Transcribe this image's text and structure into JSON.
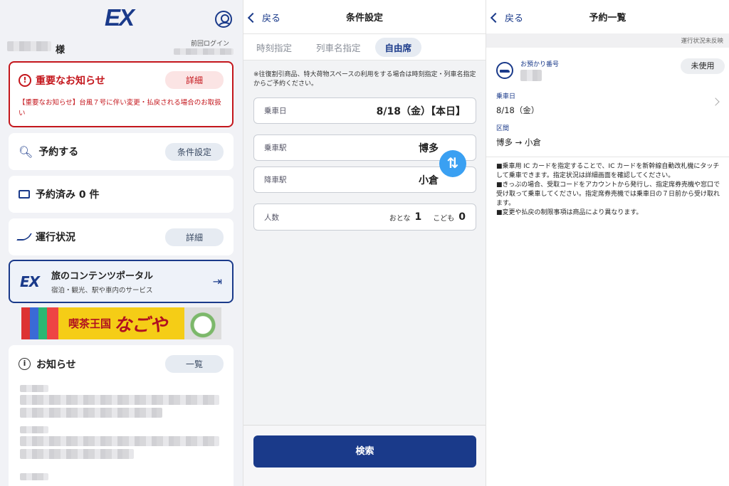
{
  "home": {
    "logo": "EX",
    "user_suffix": "様",
    "last_login_label": "前回ログイン",
    "alert": {
      "title": "重要なお知らせ",
      "button": "詳細",
      "body": "【重要なお知らせ】台風７号に伴い変更・払戻される場合のお取扱い"
    },
    "reserve": {
      "title": "予約する",
      "button": "条件設定"
    },
    "reserved": {
      "title": "予約済み 0 件"
    },
    "operation": {
      "title": "運行状況",
      "button": "詳細"
    },
    "portal": {
      "logo": "EX",
      "title": "旅のコンテンツポータル",
      "subtitle": "宿泊・観光、駅や車内のサービス"
    },
    "banner": {
      "text1": "喫茶王国",
      "text2": "なごや"
    },
    "notices": {
      "title": "お知らせ",
      "button": "一覧"
    },
    "accent": "#1a3a8a",
    "alert_color": "#c4161c"
  },
  "conditions": {
    "back": "戻る",
    "title": "条件設定",
    "tabs": [
      "時刻指定",
      "列車名指定",
      "自由席"
    ],
    "active_tab": "自由席",
    "note": "※往復割引商品、特大荷物スペースの利用をする場合は時刻指定・列車名指定からご予約ください。",
    "date_label": "乗車日",
    "date_value": "8/18（金）【本日】",
    "from_label": "乗車駅",
    "from_value": "博多",
    "to_label": "降車駅",
    "to_value": "小倉",
    "persons_label": "人数",
    "adult_label": "おとな",
    "adult_count": "1",
    "child_label": "こども",
    "child_count": "0",
    "search_button": "検索",
    "swap_icon": "swap-arrows-icon"
  },
  "reservations": {
    "back": "戻る",
    "title": "予約一覧",
    "status_note": "運行状況未反映",
    "booking_label": "お預かり番号",
    "status_badge": "未使用",
    "date_label": "乗車日",
    "date_value": "8/18（金）",
    "section_label": "区間",
    "route": "博多 → 小倉",
    "notes": [
      "■乗車用 IC カードを指定することで、IC カードを新幹線自動改札機にタッチして乗車できます。指定状況は詳細画面を確認してください。",
      "■きっぷの場合、受取コードをアカウントから発行し、指定席券売機や窓口で受け取って乗車してください。指定席券売機では乗車日の７日前から受け取れます。",
      "■変更や払戻の制限事項は商品により異なります。"
    ]
  }
}
